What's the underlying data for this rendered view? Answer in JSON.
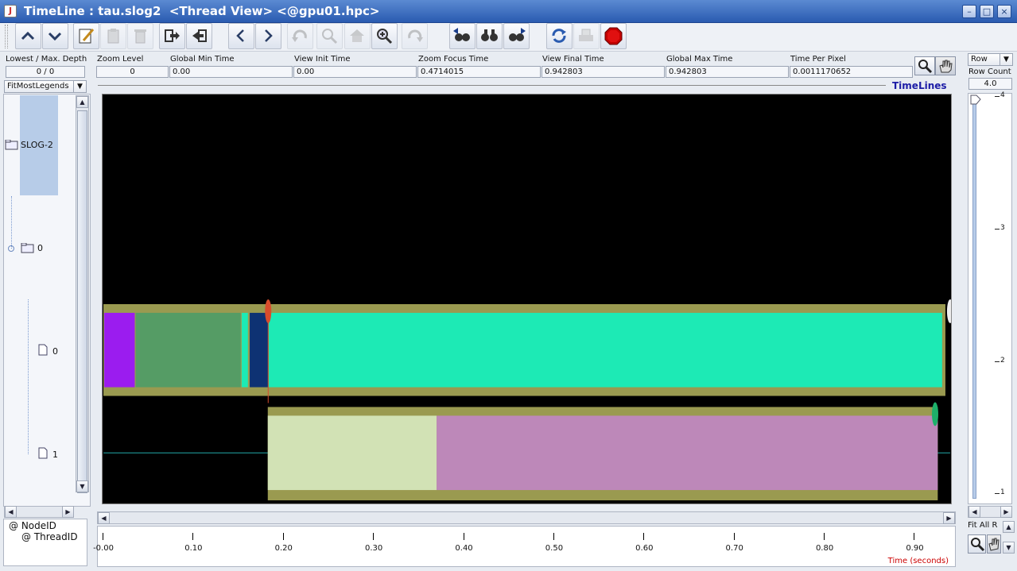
{
  "window": {
    "title": "TimeLine : tau.slog2  <Thread View> <@gpu01.hpc>",
    "app_icon_glyph": "J",
    "controls": {
      "minimize": "–",
      "maximize": "□",
      "close": "×"
    }
  },
  "toolbar": {
    "icons": [
      "up-arrow-icon",
      "down-arrow-icon",
      "edit-icon",
      "clipboard-icon",
      "trash-icon",
      "export-icon",
      "import-icon",
      "back-icon",
      "forward-icon",
      "undo-icon",
      "zoom-out-icon",
      "home-icon",
      "zoom-in-icon",
      "redo-icon",
      "search-backward-icon",
      "search-icon",
      "search-forward-icon",
      "refresh-icon",
      "print-icon",
      "stop-icon"
    ]
  },
  "info": {
    "depth_label": "Lowest / Max. Depth",
    "depth_value": "0 / 0",
    "legend_mode": "FitMostLegends",
    "fields": [
      {
        "label": "Zoom Level",
        "value": "0"
      },
      {
        "label": "Global Min Time",
        "value": "0.00"
      },
      {
        "label": "View  Init Time",
        "value": "0.00"
      },
      {
        "label": "Zoom Focus Time",
        "value": "0.4714015"
      },
      {
        "label": "View Final Time",
        "value": "0.942803"
      },
      {
        "label": "Global Max Time",
        "value": "0.942803"
      },
      {
        "label": "Time Per Pixel",
        "value": "0.0011170652"
      }
    ]
  },
  "tree": {
    "root": "SLOG-2",
    "node": "0",
    "threads": [
      "0",
      "1"
    ],
    "labels": [
      "@ NodeID",
      "@ ThreadID"
    ]
  },
  "timelines": {
    "title": "TimeLines",
    "axis_unit_label": "Time (seconds)",
    "ticks": [
      "-0.00",
      "0.10",
      "0.20",
      "0.30",
      "0.40",
      "0.50",
      "0.60",
      "0.70",
      "0.80",
      "0.90"
    ],
    "tick_values": [
      0,
      0.1,
      0.2,
      0.3,
      0.4,
      0.5,
      0.6,
      0.7,
      0.8,
      0.9
    ],
    "view_start": 0.0,
    "view_end": 0.942803,
    "colors": {
      "outer": "#9a9a50",
      "violet": "#9b1cef",
      "green": "#559c65",
      "navy": "#0e3273",
      "cyan": "#1deab5",
      "pale": "#d2e2b5",
      "mauve": "#bd88b9",
      "red_marker": "#d84c2c",
      "green_marker": "#1db06a"
    },
    "thread0_states": [
      {
        "color": "violet",
        "start": 0.0,
        "end": 0.034
      },
      {
        "color": "green",
        "start": 0.035,
        "end": 0.152
      },
      {
        "color": "cyan",
        "start": 0.153,
        "end": 0.16
      },
      {
        "color": "navy",
        "start": 0.162,
        "end": 0.183
      },
      {
        "color": "cyan",
        "start": 0.183,
        "end": 0.933
      }
    ],
    "thread1_states": [
      {
        "color": "pale",
        "start": 0.183,
        "end": 0.371
      },
      {
        "color": "mauve",
        "start": 0.371,
        "end": 0.929
      }
    ]
  },
  "right": {
    "row_mode": "Row",
    "row_count_label": "Row Count",
    "row_count_value": "4.0",
    "slider_ticks": [
      "4",
      "3",
      "2",
      "1"
    ],
    "fit_label": "Fit All R"
  }
}
